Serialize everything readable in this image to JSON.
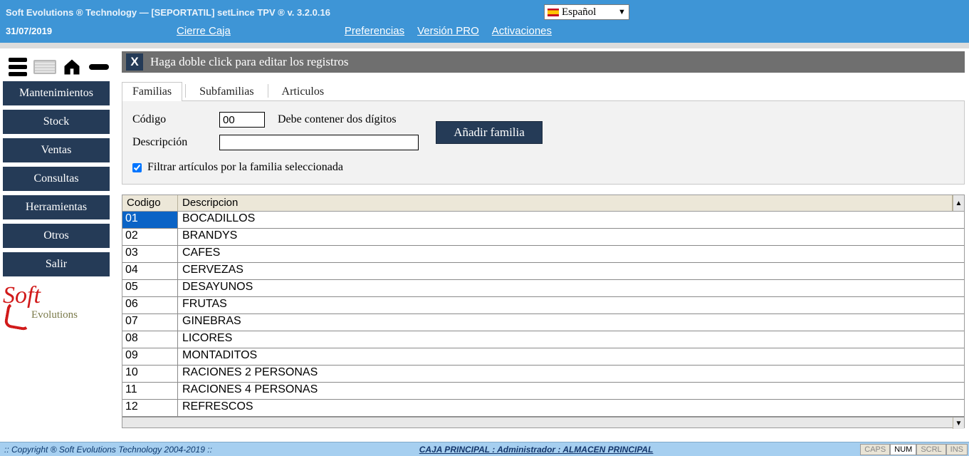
{
  "header": {
    "title": "Soft Evolutions ® Technology — [SEPORTATIL] setLince TPV ® v. 3.2.0.16",
    "language": "Español",
    "date": "31/07/2019",
    "link_cierre": "Cierre Caja",
    "link_pref": "Preferencias",
    "link_pro": "Versión PRO",
    "link_activ": "Activaciones"
  },
  "sidebar": {
    "items": [
      "Mantenimientos",
      "Stock",
      "Ventas",
      "Consultas",
      "Herramientas",
      "Otros",
      "Salir"
    ]
  },
  "section": {
    "close": "X",
    "title": "Haga doble click para editar los registros"
  },
  "tabs": {
    "t0": "Familias",
    "t1": "Subfamilias",
    "t2": "Articulos"
  },
  "form": {
    "label_codigo": "Código",
    "value_codigo": "00",
    "hint_codigo": "Debe contener dos dígitos",
    "label_desc": "Descripción",
    "value_desc": "",
    "add_btn": "Añadir familia",
    "filter_checked": true,
    "filter_label": "Filtrar artículos por la familia seleccionada"
  },
  "table": {
    "headers": {
      "codigo": "Codigo",
      "desc": "Descripcion"
    },
    "rows": [
      {
        "codigo": "01",
        "desc": "BOCADILLOS",
        "selected": true
      },
      {
        "codigo": "02",
        "desc": "BRANDYS"
      },
      {
        "codigo": "03",
        "desc": "CAFES"
      },
      {
        "codigo": "04",
        "desc": "CERVEZAS"
      },
      {
        "codigo": "05",
        "desc": "DESAYUNOS"
      },
      {
        "codigo": "06",
        "desc": "FRUTAS"
      },
      {
        "codigo": "07",
        "desc": "GINEBRAS"
      },
      {
        "codigo": "08",
        "desc": "LICORES"
      },
      {
        "codigo": "09",
        "desc": "MONTADITOS"
      },
      {
        "codigo": "10",
        "desc": "RACIONES 2 PERSONAS"
      },
      {
        "codigo": "11",
        "desc": "RACIONES 4 PERSONAS"
      },
      {
        "codigo": "12",
        "desc": "REFRESCOS"
      }
    ]
  },
  "status": {
    "copyright": ":: Copyright ® Soft Evolutions Technology 2004-2019 ::",
    "center": "CAJA PRINCIPAL : Administrador : ALMACEN PRINCIPAL",
    "caps": "CAPS",
    "num": "NUM",
    "scrl": "SCRL",
    "ins": "INS"
  }
}
